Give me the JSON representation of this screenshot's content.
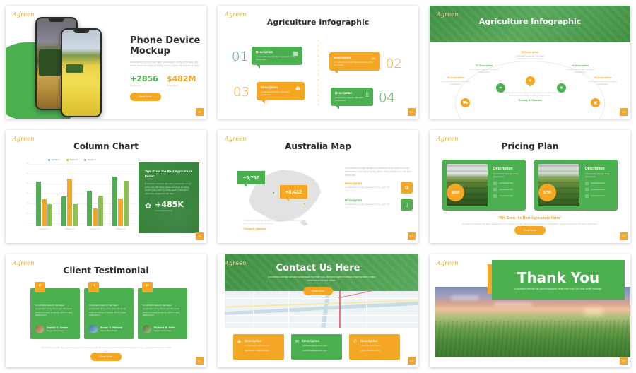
{
  "brand": {
    "logo_text": "Agreen",
    "green": "#4caf50",
    "dark_green": "#3f8f43",
    "orange": "#f5a623",
    "gold": "#d8a93a"
  },
  "lorem": {
    "short": "A wonderful serenity has taken possession",
    "medium": "A wonderful serenity has taken possession of my entire soul, like these sweet mornings of spring which I enjoy",
    "long": "A wonderful serenity has taken possession of my entire soul, like these sweet mornings of spring which I enjoy with my whole heart. I am alone."
  },
  "slides": [
    {
      "id": "phone-device-mockup",
      "page": "01",
      "title": "Phone Device Mockup",
      "body": "A wonderful serenity has taken possession of my entire soul, like these sweet mornings of spring which I enjoy with my whole heart.",
      "stats": [
        {
          "value": "+2856",
          "caption": "Description",
          "color": "#4caf50"
        },
        {
          "value": "$482M",
          "caption": "Description",
          "color": "#f5a623"
        }
      ],
      "button": "Read More"
    },
    {
      "id": "agriculture-infographic-bubbles",
      "page": "02",
      "title": "Agriculture Infographic",
      "items": [
        {
          "num": "01",
          "heading": "Description",
          "body": "A wonderful serenity has possession of my entire soul.",
          "color": "green",
          "icon": "calendar-icon"
        },
        {
          "num": "02",
          "heading": "Description",
          "body": "A wonderful serenity has possession of my entire soul.",
          "color": "orange",
          "icon": "wheat-icon"
        },
        {
          "num": "03",
          "heading": "Description",
          "body": "A wonderful serenity has taken possession.",
          "color": "orange",
          "icon": "farmer-icon"
        },
        {
          "num": "04",
          "heading": "Description",
          "body": "A wonderful serenity has taken possession.",
          "color": "green",
          "icon": "phone-icon"
        }
      ]
    },
    {
      "id": "agriculture-infographic-arc",
      "page": "03",
      "title": "Agriculture Infographic",
      "nodes": [
        {
          "heading": "01.Description",
          "body": "A wonderful serenity has taken possession",
          "color": "orange",
          "icon": "tractor-icon"
        },
        {
          "heading": "02.Description",
          "body": "A wonderful serenity has taken possession",
          "color": "green",
          "icon": "leaf-icon"
        },
        {
          "heading": "03.Description",
          "body": "A wonderful serenity has taken possession out these sweet",
          "color": "orange",
          "icon": "sun-icon"
        },
        {
          "heading": "04.Description",
          "body": "A wonderful serenity has taken possession",
          "color": "green",
          "icon": "seed-icon"
        },
        {
          "heading": "05.Description",
          "body": "A wonderful serenity has taken possession",
          "color": "orange",
          "icon": "basket-icon"
        }
      ],
      "quote": {
        "mark": "”",
        "body": "A wonderful serenity has taken possession of my entire soul, like these sweet mornings of spring which I enjoy.",
        "author": "Thomas B. Sanchez"
      }
    },
    {
      "id": "column-chart",
      "page": "04",
      "title": "Column Chart",
      "card": {
        "heading": "“We Grow the Best Agriculture Farm”",
        "body": "A wonderful serenity has taken possession of my entire soul, like these sweet mornings of spring which I enjoy with my whole heart, in this spot, which was created for the bliss.",
        "value": "+485K",
        "caption": "A wonderful serenity",
        "icon": "wheat-icon"
      },
      "chart_data": {
        "type": "bar",
        "title": "Column Chart",
        "categories": [
          "Category 1",
          "Category 2",
          "Category 3",
          "Category 4"
        ],
        "series": [
          {
            "name": "Series 1",
            "color": "#4caf50",
            "values": [
              45,
              30,
              36,
              50
            ]
          },
          {
            "name": "Series 2",
            "color": "#f5a623",
            "values": [
              27,
              48,
              18,
              28
            ]
          },
          {
            "name": "Series 3",
            "color": "#8bc34a",
            "values": [
              22,
              22,
              31,
              46
            ]
          }
        ],
        "ylim": [
          0,
          60
        ],
        "yticks": [
          "0",
          "10",
          "20",
          "30",
          "40",
          "50",
          "60"
        ],
        "xlabel": "",
        "ylabel": "",
        "grid": true,
        "legend_position": "top"
      }
    },
    {
      "id": "australia-map",
      "page": "05",
      "title": "Australia Map",
      "tags": [
        {
          "value": "+5,750",
          "color": "#4caf50"
        },
        {
          "value": "+8,432",
          "color": "#f5a623"
        }
      ],
      "intro": "A wonderful serenity has taken possession of my entire soul, like these sweet mornings of spring which I enjoy existence in this spot, which was.",
      "items": [
        {
          "heading": "Description",
          "body": "A wonderful serenity possession entire soul, like these sweet.",
          "color": "orange",
          "icon": "wheat-icon"
        },
        {
          "heading": "Description",
          "body": "A wonderful serenity possession entire soul, like these sweet.",
          "color": "green",
          "icon": "phone-icon"
        }
      ],
      "quote": {
        "body": "“A wonderful serenity has taken possession of my entire soul, like these sweet mornings of spring.”",
        "author": "Thomas B. Sanchez"
      }
    },
    {
      "id": "pricing-plan",
      "page": "06",
      "title": "Pricing Plan",
      "plans": [
        {
          "badge": "$550",
          "heading": "Description",
          "body": "A wonderful serenity taken possession.",
          "features": [
            "A wonderful has",
            "A wonderful has",
            "A wonderful has"
          ]
        },
        {
          "badge": "$750",
          "heading": "Description",
          "body": "A wonderful serenity taken possession.",
          "features": [
            "A wonderful has",
            "A wonderful has",
            "A wonderful has"
          ]
        }
      ],
      "quote": {
        "heading": "“We Grow the Best Agriculture Farm”",
        "body": "A wonderful serenity has taken possession of my entire soul, like these sweet mornings of spring which I enjoy existence in this spot, which was."
      },
      "button": "Read More"
    },
    {
      "id": "client-testimonial",
      "page": "07",
      "title": "Client Testimonial",
      "testimonials": [
        {
          "quote_mark": "”",
          "body": "A wonderful serenity has taken possession of my entire soul, like these sweet mornings of spring, which I enjoy existence in.",
          "name": "Donald S. Antine",
          "role": "Agreen Farm Team"
        },
        {
          "quote_mark": "”",
          "body": "A wonderful serenity has taken possession of my entire soul, like these sweet mornings of spring, which I enjoy existence in.",
          "name": "Susan D. Riehma",
          "role": "Agreen Farm Team"
        },
        {
          "quote_mark": "”",
          "body": "A wonderful serenity has taken possession of my entire soul, like these sweet mornings of spring, which I enjoy existence in.",
          "name": "Richard M. Adler",
          "role": "Agreen Farm Team"
        }
      ],
      "footer": "A wonderful serenity has taken possession of my entire soul, like these sweet mornings of spring which I enjoy existence in this spot, which was.",
      "button": "Read More"
    },
    {
      "id": "contact-us",
      "page": "08",
      "title": "Contact Us Here",
      "subtitle": "A wonderful serenity has taken possession my entire soul, like these sweet mornings of spring which I enjoy existence in this spot, which.",
      "button": "Read More",
      "cards": [
        {
          "heading": "Description",
          "lines": [
            "Jl. Agriculture Farm No.12",
            "Melbourne, Australia 3000"
          ],
          "color": "orange",
          "icon": "location-icon"
        },
        {
          "heading": "Description",
          "lines": [
            "yourname@agrofarm.com",
            "yourname@agrofarm.com"
          ],
          "color": "green",
          "icon": "mail-icon"
        },
        {
          "heading": "Description",
          "lines": [
            "+(62) 123 4567 8910",
            "+(62) 123 4567 8910"
          ],
          "color": "orange",
          "icon": "phone-icon"
        }
      ]
    },
    {
      "id": "thank-you",
      "page": "09",
      "title": "Thank You",
      "subtitle": "A wonderful serenity has taken possession of my entire soul, like these sweet mornings."
    }
  ]
}
